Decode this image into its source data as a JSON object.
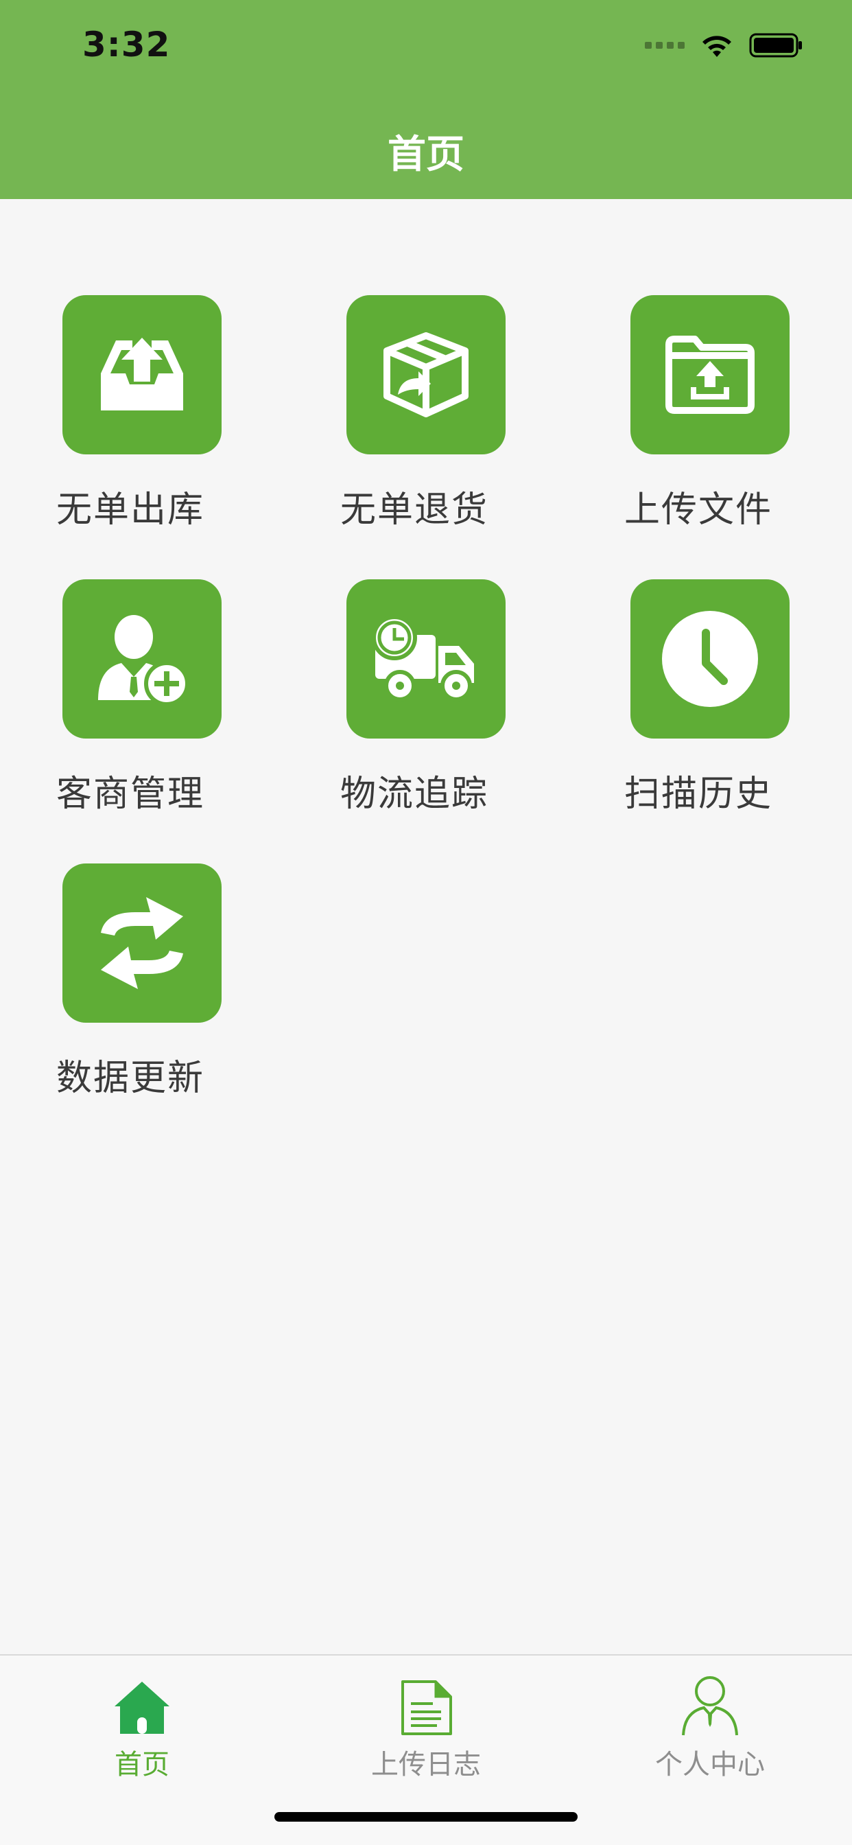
{
  "status_bar": {
    "time": "3:32"
  },
  "nav": {
    "title": "首页"
  },
  "menu_items": [
    {
      "label": "无单出库",
      "icon": "inbox-upload-icon"
    },
    {
      "label": "无单退货",
      "icon": "box-return-icon"
    },
    {
      "label": "上传文件",
      "icon": "folder-upload-icon"
    },
    {
      "label": "客商管理",
      "icon": "user-add-icon"
    },
    {
      "label": "物流追踪",
      "icon": "truck-clock-icon"
    },
    {
      "label": "扫描历史",
      "icon": "clock-icon"
    },
    {
      "label": "数据更新",
      "icon": "refresh-icon"
    }
  ],
  "tabbar": {
    "items": [
      {
        "label": "首页",
        "icon": "home-icon",
        "active": true
      },
      {
        "label": "上传日志",
        "icon": "document-icon",
        "active": false
      },
      {
        "label": "个人中心",
        "icon": "person-icon",
        "active": false
      }
    ]
  },
  "colors": {
    "header": "#75b652",
    "tile": "#5fad36",
    "tab_active": "#59ac33",
    "tab_inactive": "#8e8e8e"
  }
}
